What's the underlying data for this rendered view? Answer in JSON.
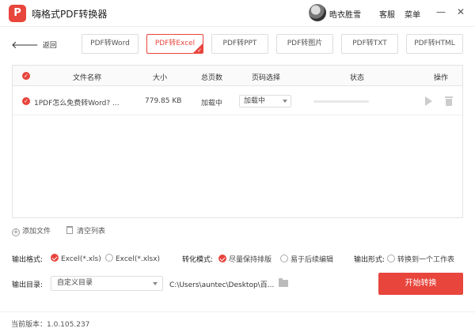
{
  "app": {
    "logo_text": "P",
    "title": "嗨格式PDF转换器"
  },
  "user": {
    "name": "晧衣胜雪"
  },
  "header_links": {
    "service": "客服",
    "menu": "菜单"
  },
  "window_buttons": {
    "minimize": "—",
    "close": "✕"
  },
  "nav": {
    "back_label": "返回",
    "back_arrow": "🡐"
  },
  "tabs": [
    {
      "label": "PDF转Word",
      "active": false
    },
    {
      "label": "PDF转Excel",
      "active": true
    },
    {
      "label": "PDF转PPT",
      "active": false
    },
    {
      "label": "PDF转图片",
      "active": false
    },
    {
      "label": "PDF转TXT",
      "active": false
    },
    {
      "label": "PDF转HTML",
      "active": false
    }
  ],
  "table": {
    "columns": {
      "name": "文件名称",
      "size": "大小",
      "pages": "总页数",
      "page_select": "页码选择",
      "status": "状态",
      "actions": "操作"
    },
    "rows": [
      {
        "name": "1PDF怎么免费转Word? ...",
        "size": "779.85 KB",
        "pages": "加载中",
        "page_select": "加载中",
        "progress": 0
      }
    ]
  },
  "actions": {
    "add_file": "添加文件",
    "clear_list": "清空列表"
  },
  "options": {
    "output_format_label": "输出格式:",
    "format_xls": "Excel(*.xls)",
    "format_xlsx": "Excel(*.xlsx)",
    "convert_mode_label": "转化模式:",
    "mode_keep_layout": "尽量保持排版",
    "mode_easy_edit": "易于后续编辑",
    "output_form_label": "输出形式:",
    "form_one_sheet": "转换到一个工作表",
    "output_dir_label": "输出目录:",
    "dir_select_value": "自定义目录",
    "dir_path": "C:\\Users\\auntec\\Desktop\\百..."
  },
  "start_button": "开始转换",
  "footer": {
    "version": "当前版本：1.0.105.237"
  },
  "colors": {
    "accent": "#e8453c"
  },
  "icons": [
    "check-icon",
    "play-icon",
    "trash-icon",
    "plus-icon",
    "folder-icon",
    "back-arrow-icon"
  ]
}
